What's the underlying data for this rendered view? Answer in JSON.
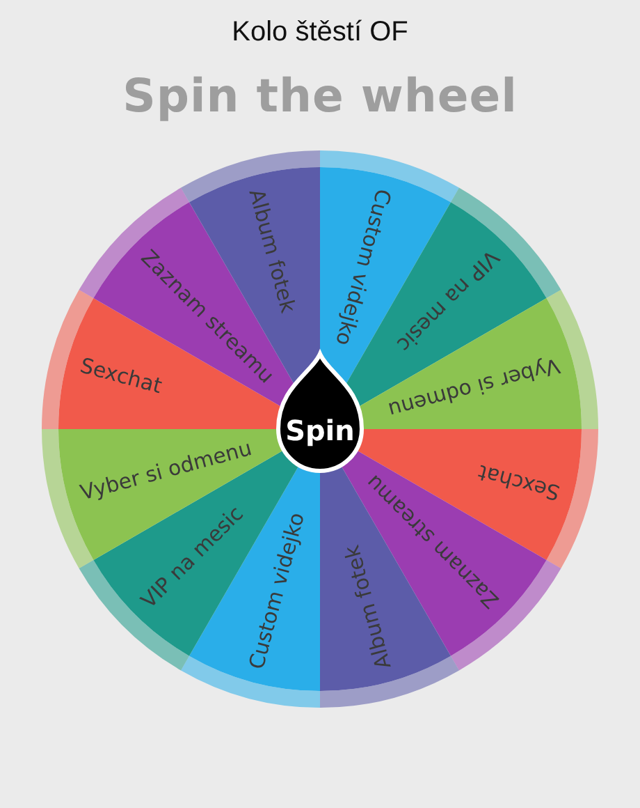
{
  "app_title": "Kolo štěstí OF",
  "heading": "Spin the wheel",
  "wheel": {
    "segments": [
      {
        "label": "Custom videjko",
        "color": "#2aaee9"
      },
      {
        "label": "VIP na mesic",
        "color": "#1e9a8b"
      },
      {
        "label": "Vyber si odmenu",
        "color": "#8cc351"
      },
      {
        "label": "Sexchat",
        "color": "#f15a4b"
      },
      {
        "label": "Zaznam streamu",
        "color": "#9b3db1"
      },
      {
        "label": "Album fotek",
        "color": "#5c5ca9"
      },
      {
        "label": "Custom videjko",
        "color": "#2aaee9"
      },
      {
        "label": "VIP na mesic",
        "color": "#1e9a8b"
      },
      {
        "label": "Vyber si odmenu",
        "color": "#8cc351"
      },
      {
        "label": "Sexchat",
        "color": "#f15a4b"
      },
      {
        "label": "Zaznam streamu",
        "color": "#9b3db1"
      },
      {
        "label": "Album fotek",
        "color": "#5c5ca9"
      }
    ],
    "spin_button": "Spin"
  }
}
